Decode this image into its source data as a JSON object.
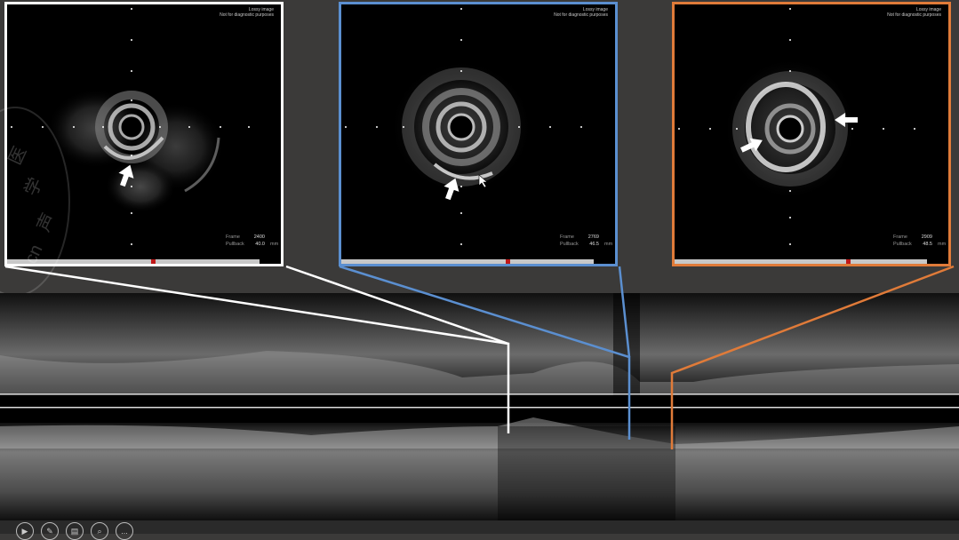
{
  "panels": [
    {
      "id": "p1",
      "border": "#ffffff",
      "header": [
        "Lossy image",
        "Not for diagnostic purposes"
      ],
      "frame_label": "Frame",
      "frame": "2400",
      "pullback_label": "Pullback",
      "pullback": "40.0",
      "unit": "mm",
      "progress": 0.57
    },
    {
      "id": "p2",
      "border": "#5b8fd0",
      "header": [
        "Lossy image",
        "Not for diagnostic purposes"
      ],
      "frame_label": "Frame",
      "frame": "2769",
      "pullback_label": "Pullback",
      "pullback": "46.5",
      "unit": "mm",
      "progress": 0.65
    },
    {
      "id": "p3",
      "border": "#e07b39",
      "header": [
        "Lossy image",
        "Not for diagnostic purposes"
      ],
      "frame_label": "Frame",
      "frame": "2909",
      "pullback_label": "Pullback",
      "pullback": "48.5",
      "unit": "mm",
      "progress": 0.68
    }
  ],
  "watermark": {
    "chars": [
      "医",
      "学",
      "影",
      "声"
    ],
    "domain": "cn"
  },
  "toolbar": {
    "icons": [
      "play-icon",
      "pen-icon",
      "gallery-icon",
      "zoom-icon",
      "more-icon"
    ],
    "more": "..."
  },
  "colors": {
    "white": "#ffffff",
    "blue": "#5b8fd0",
    "orange": "#e07b39",
    "marker": "#c01818"
  }
}
